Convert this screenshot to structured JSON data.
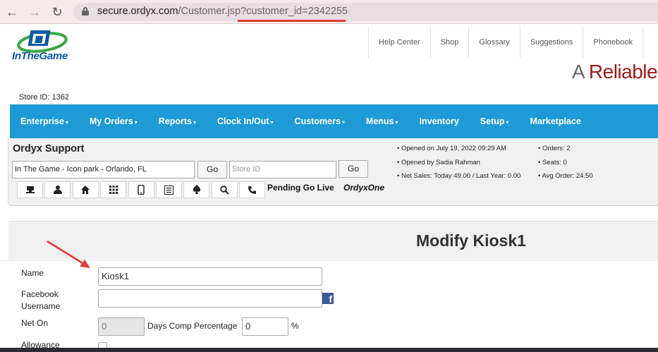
{
  "browser": {
    "url_host": "secure.ordyx.com",
    "url_path": "/Customer.jsp?customer_id=2342255"
  },
  "header": {
    "logo_text": "InTheGame",
    "links": [
      "Help Center",
      "Shop",
      "Glossary",
      "Suggestions",
      "Phonebook"
    ],
    "tagline_prefix": "A",
    "tagline_red": "Reliable",
    "store_id": "Store ID: 1362"
  },
  "nav": {
    "items": [
      {
        "label": "Enterprise",
        "dropdown": true
      },
      {
        "label": "My Orders",
        "dropdown": true
      },
      {
        "label": "Reports",
        "dropdown": true
      },
      {
        "label": "Clock In/Out",
        "dropdown": true
      },
      {
        "label": "Customers",
        "dropdown": true
      },
      {
        "label": "Menus",
        "dropdown": true
      },
      {
        "label": "Inventory",
        "dropdown": false
      },
      {
        "label": "Setup",
        "dropdown": true
      },
      {
        "label": "Marketplace",
        "dropdown": false
      }
    ],
    "caret": "▾"
  },
  "support": {
    "title": "Ordyx Support",
    "store_select": "In The Game - Icon park  - Orlando, FL",
    "go_label": "Go",
    "store_id_placeholder": "Store ID",
    "pending": "Pending Go Live",
    "ordyx_one": "OrdyxOne",
    "stats_left": [
      "• Opened on July 19, 2022 09:29 AM",
      "• Opened by Sadia Rahman",
      "• Net Sales: Today 49.00 / Last Year: 0.00"
    ],
    "stats_right": [
      "• Orders: 2",
      "• Seats: 0",
      "• Avg Order: 24.50"
    ],
    "icons": [
      "register-icon",
      "person-icon",
      "home-icon",
      "grid-icon",
      "mobile-icon",
      "list-icon",
      "spade-icon",
      "search-icon",
      "phone-icon"
    ]
  },
  "form": {
    "title": "Modify Kiosk1",
    "name_label": "Name",
    "name_value": "Kiosk1",
    "facebook_label_1": "Facebook",
    "facebook_label_2": "Username",
    "facebook_value": "",
    "net_on_label": "Net On",
    "net_on_value": "0",
    "days_comp_label": "Days Comp Percentage",
    "comp_value": "0",
    "percent": "%",
    "allowance_label": "Allowance"
  },
  "colors": {
    "nav_blue": "#1e9ad6",
    "tagline_red": "#a01818",
    "logo_blue": "#0b5aa8",
    "annotation_red": "#e53935"
  }
}
